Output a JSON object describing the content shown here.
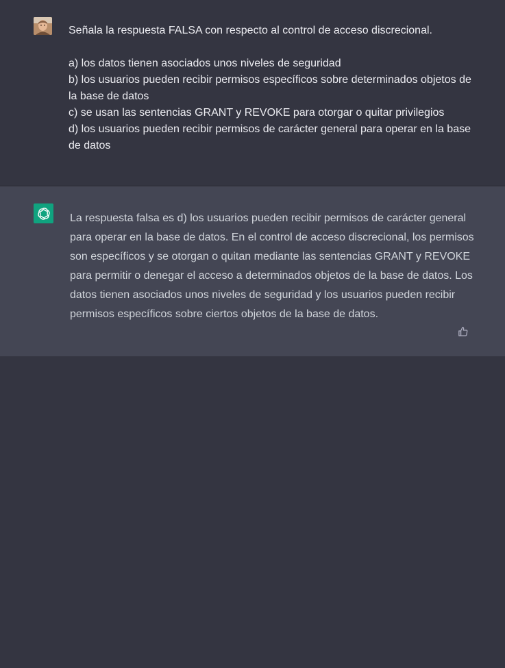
{
  "user_message": {
    "question": "Señala la respuesta FALSA con respecto al control de acceso discrecional.",
    "options": [
      "a) los datos tienen asociados unos niveles de seguridad",
      "b) los usuarios pueden recibir permisos específicos sobre determinados objetos de la base de datos",
      "c) se usan las sentencias GRANT y REVOKE para otorgar o quitar privilegios",
      "d) los usuarios pueden recibir permisos de carácter general para operar en la base de datos"
    ]
  },
  "assistant_message": {
    "text": "La respuesta falsa es d) los usuarios pueden recibir permisos de carácter general para operar en la base de datos. En el control de acceso discrecional, los permisos son específicos y se otorgan o quitan mediante las sentencias GRANT y REVOKE para permitir o denegar el acceso a determinados objetos de la base de datos. Los datos tienen asociados unos niveles de seguridad y los usuarios pueden recibir permisos específicos sobre ciertos objetos de la base de datos."
  },
  "icons": {
    "user_avatar": "user-avatar",
    "assistant_logo": "openai-logo-icon",
    "feedback": "thumbs-up-icon"
  },
  "colors": {
    "background": "#343541",
    "assistant_background": "#444654",
    "assistant_logo_bg": "#10a37f",
    "user_text": "#ececf1",
    "assistant_text": "#d1d5db"
  }
}
